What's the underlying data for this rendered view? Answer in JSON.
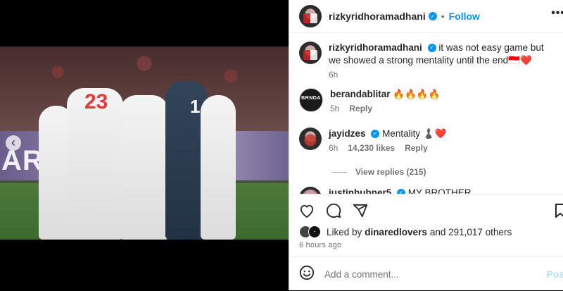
{
  "post": {
    "username": "rizkyridhoramadhani",
    "follow_label": "Follow",
    "more_label": "•••"
  },
  "media": {
    "board_text": "AR",
    "nav_left": "‹",
    "jersey_numbers": [
      "23",
      "1"
    ]
  },
  "caption": {
    "username": "rizkyridhoramadhani",
    "text": "it was not easy game but we showed a strong mentality until the end🇮🇩❤️",
    "time": "6h"
  },
  "comments": [
    {
      "username": "berandablitar",
      "text": "🔥🔥🔥🔥",
      "time": "5h",
      "reply_label": "Reply",
      "avatar_text": "BRNDA"
    },
    {
      "username": "jayidzes",
      "text": "Mentality ♟️❤️",
      "time": "6h",
      "likes": "14,230 likes",
      "reply_label": "Reply"
    },
    {
      "username": "justinhubner5",
      "text": "MY BROTHER"
    }
  ],
  "view_replies": "View replies (215)",
  "likes": {
    "prefix": "Liked by",
    "user": "dinaredlovers",
    "suffix": "and 291,017 others"
  },
  "timestamp": "6 hours ago",
  "add_comment": {
    "placeholder": "Add a comment...",
    "post_label": "Post"
  }
}
